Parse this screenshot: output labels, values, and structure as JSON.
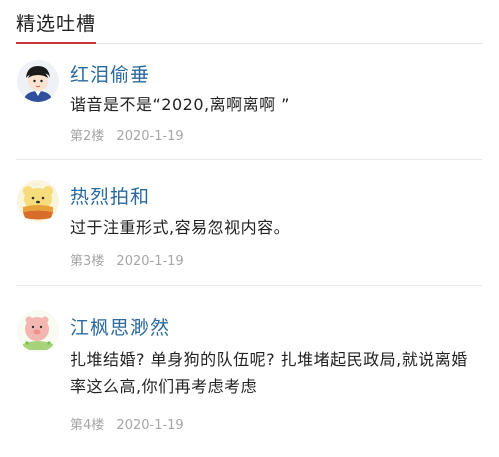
{
  "section": {
    "title": "精选吐槽"
  },
  "comments": [
    {
      "user": "红泪偷垂",
      "text": "谐音是不是“2020,离啊离啊 ”",
      "floor": "第2楼",
      "date": "2020-1-19",
      "avatar_icon": "cartoon-boy-avatar-icon"
    },
    {
      "user": "热烈拍和",
      "text": "过于注重形式,容易忽视内容。",
      "floor": "第3楼",
      "date": "2020-1-19",
      "avatar_icon": "cartoon-bear-avatar-icon"
    },
    {
      "user": "江枫思渺然",
      "text": "扎堆结婚? 单身狗的队伍呢? 扎堆堵起民政局,就说离婚率这么高,你们再考虑考虑",
      "floor": "第4楼",
      "date": "2020-1-19",
      "avatar_icon": "cartoon-pig-avatar-icon"
    }
  ],
  "colors": {
    "accent": "#c8353a",
    "username": "#2b6a9e",
    "meta": "#a6a6a6",
    "divider": "#e9e9e9"
  }
}
